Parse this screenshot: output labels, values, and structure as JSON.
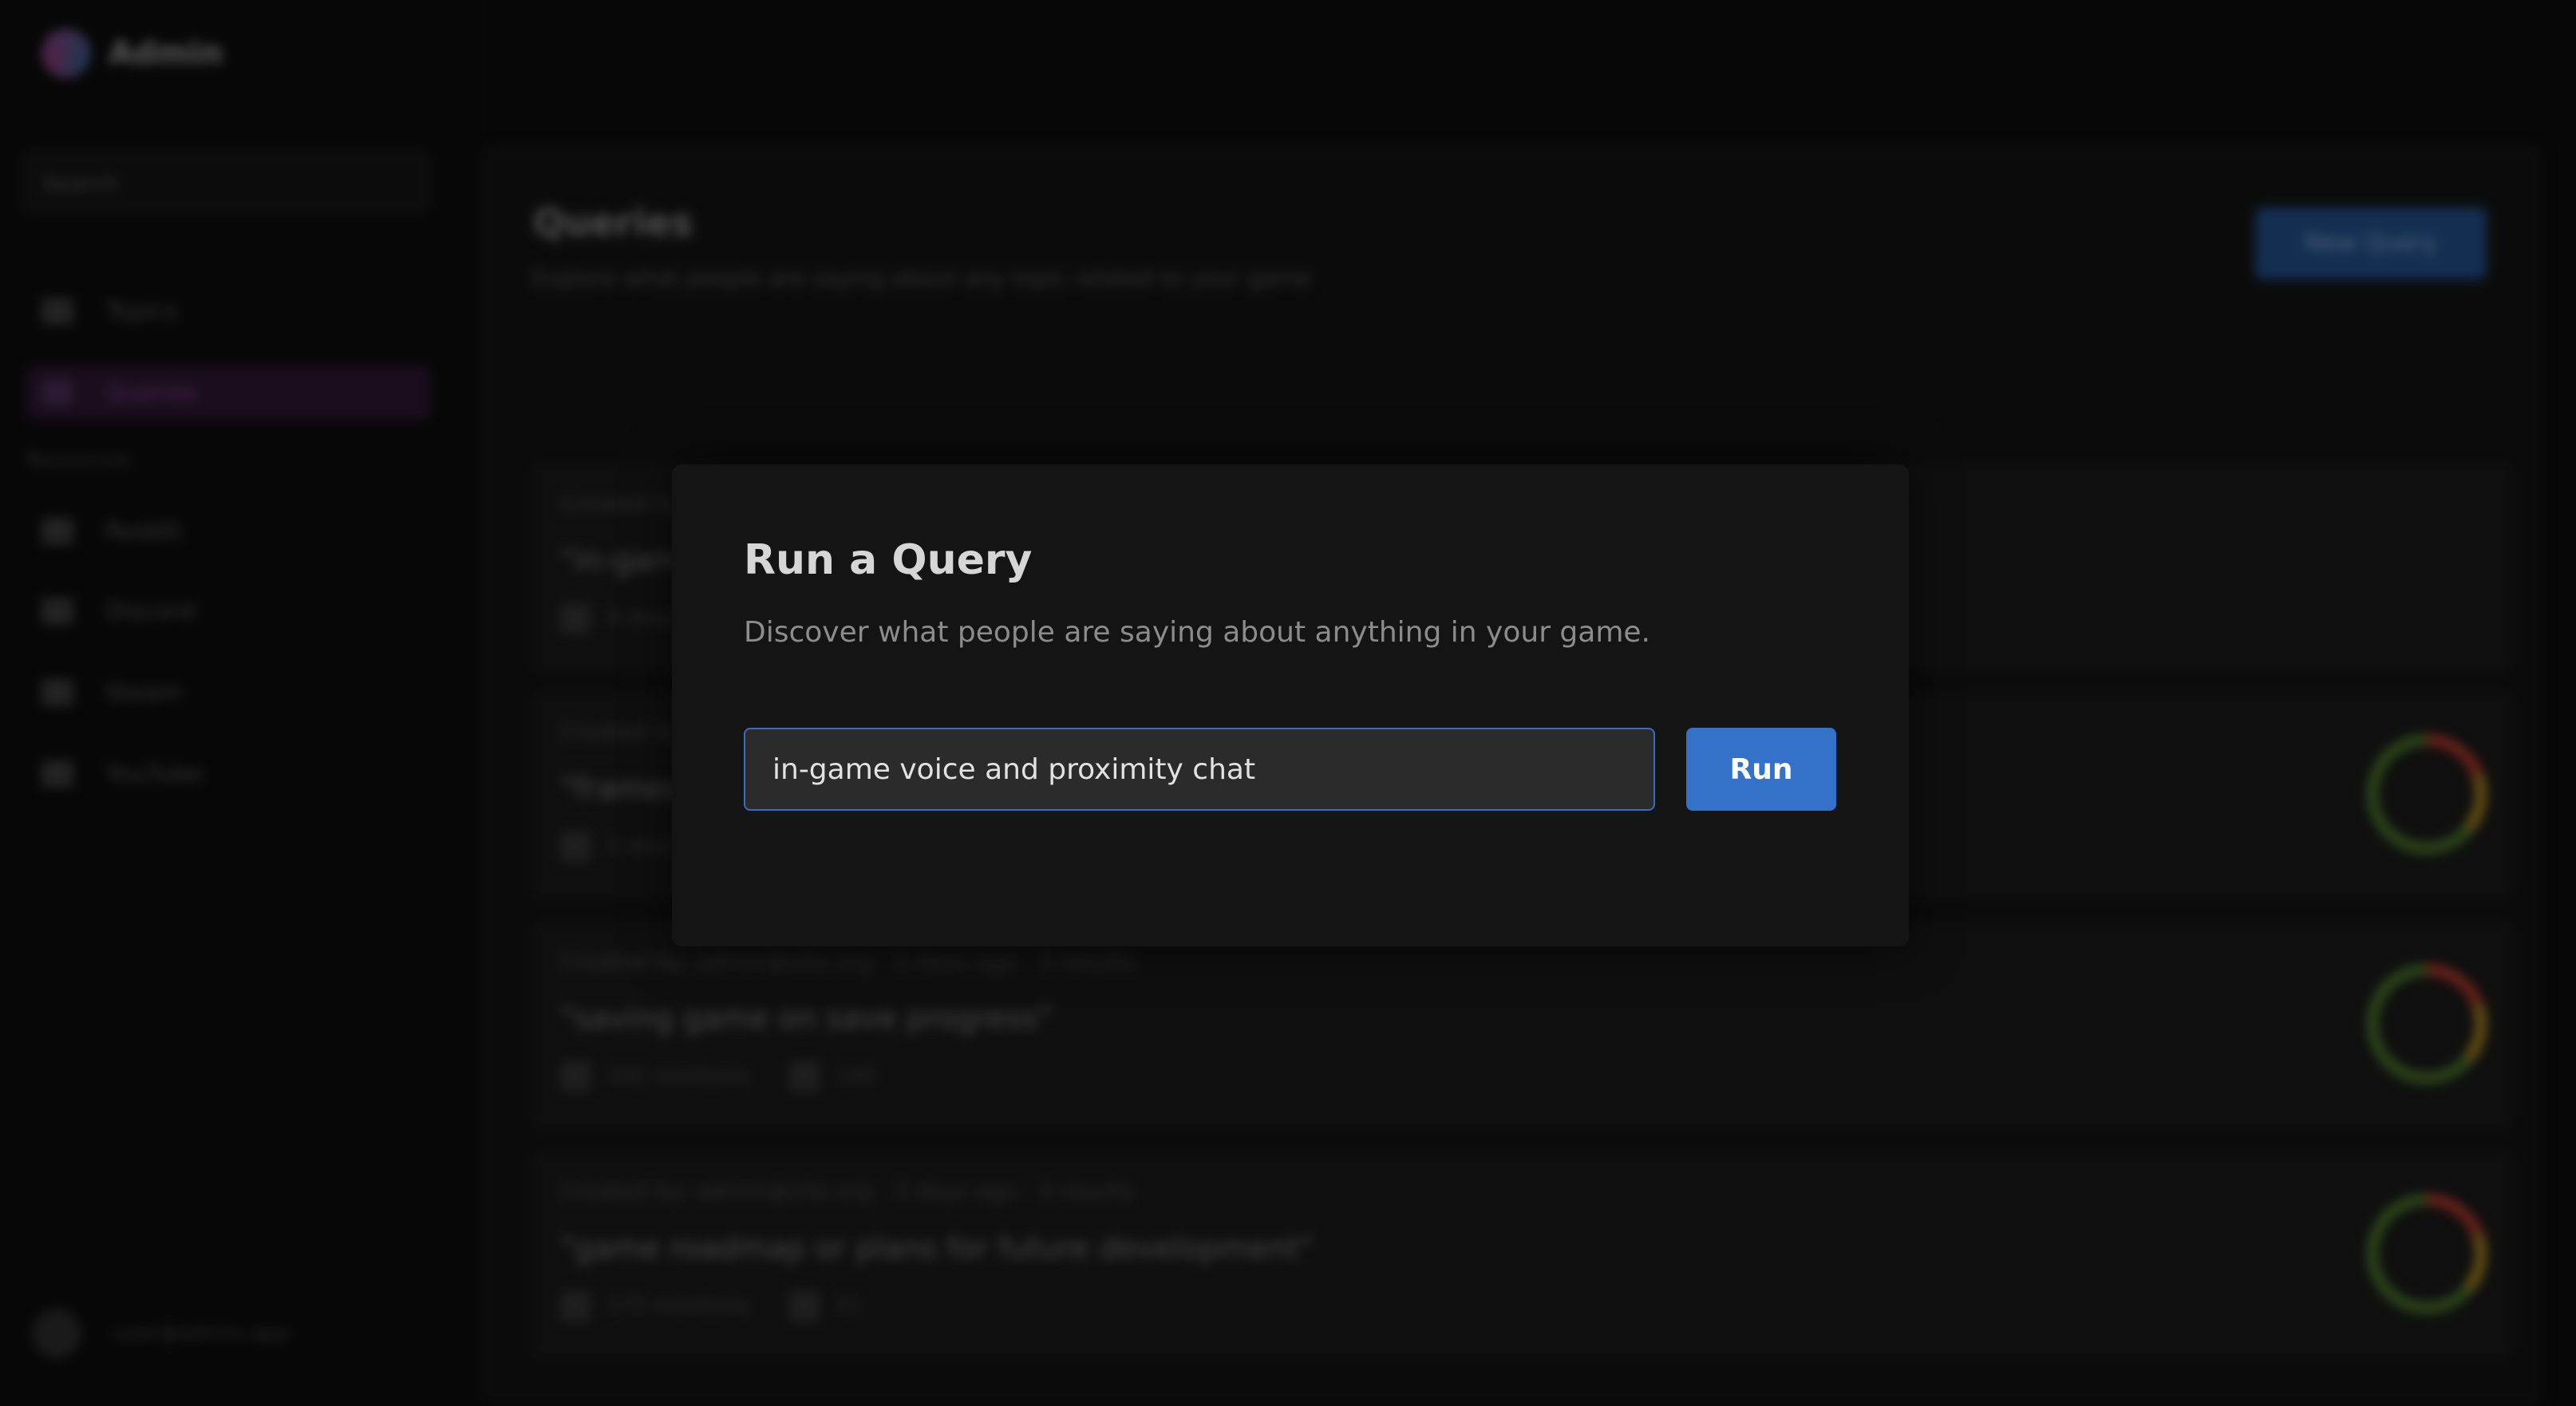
{
  "app": {
    "name": "Admin",
    "colors": {
      "accent": "#3471c9",
      "input_border": "#3a6cc2",
      "modal_bg": "#141414",
      "active_nav": "#2a1330"
    }
  },
  "sidebar": {
    "search_placeholder": "Search",
    "items": [
      {
        "label": "Topics",
        "icon": "grid-icon"
      },
      {
        "label": "Queries",
        "icon": "query-icon"
      }
    ],
    "section_label": "Resources",
    "resources": [
      {
        "label": "Reddit",
        "icon": "reddit-icon"
      },
      {
        "label": "Discord",
        "icon": "discord-icon"
      },
      {
        "label": "Steam",
        "icon": "steam-icon"
      },
      {
        "label": "YouTube",
        "icon": "youtube-icon"
      }
    ],
    "footer_user": "user@admin.app"
  },
  "main": {
    "title": "Queries",
    "subtitle": "Explore what people are saying about any topic related to your game",
    "new_query_label": "New Query",
    "cards": [
      {
        "meta": "Created by",
        "title": "\"in-game",
        "stat_a": "4 results"
      },
      {
        "meta": "Created by",
        "title": "\"frames",
        "stat_a": "1 result"
      },
      {
        "meta": "Created by: admin@site.org · 3 days ago · 3 results",
        "title": "\"saving game on save progress\"",
        "stat_a": "342 mentions",
        "stat_b": "140"
      },
      {
        "meta": "Created by: admin@site.org · 3 days ago · 3 results",
        "title": "\"game roadmap or plans for future development\"",
        "stat_a": "175 mentions",
        "stat_b": "51"
      }
    ]
  },
  "modal": {
    "title": "Run a Query",
    "description": "Discover what people are saying about anything in your game.",
    "input_value": "in-game voice and proximity chat",
    "run_label": "Run"
  }
}
